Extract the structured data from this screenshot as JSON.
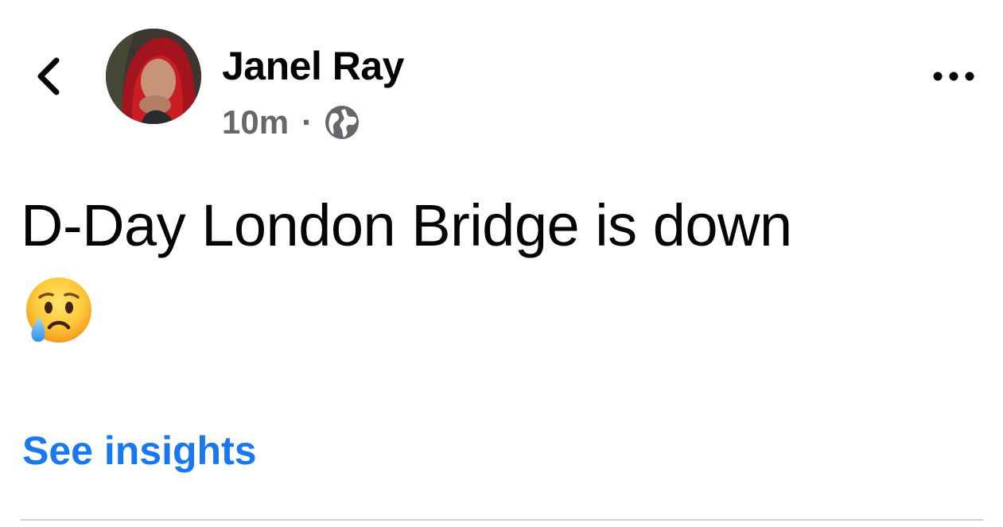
{
  "post": {
    "author_name": "Janel Ray",
    "timestamp": "10m",
    "separator": "·",
    "audience_icon": "globe-icon",
    "text": "D-Day London Bridge is down",
    "emoji": "crying-face",
    "insights_label": "See insights"
  },
  "header": {
    "back_icon": "chevron-left-icon",
    "more_icon": "more-horizontal-icon"
  },
  "colors": {
    "text_primary": "#050505",
    "text_secondary": "#65676b",
    "link": "#1877f2",
    "divider": "#cfd1d5",
    "background": "#ffffff"
  }
}
